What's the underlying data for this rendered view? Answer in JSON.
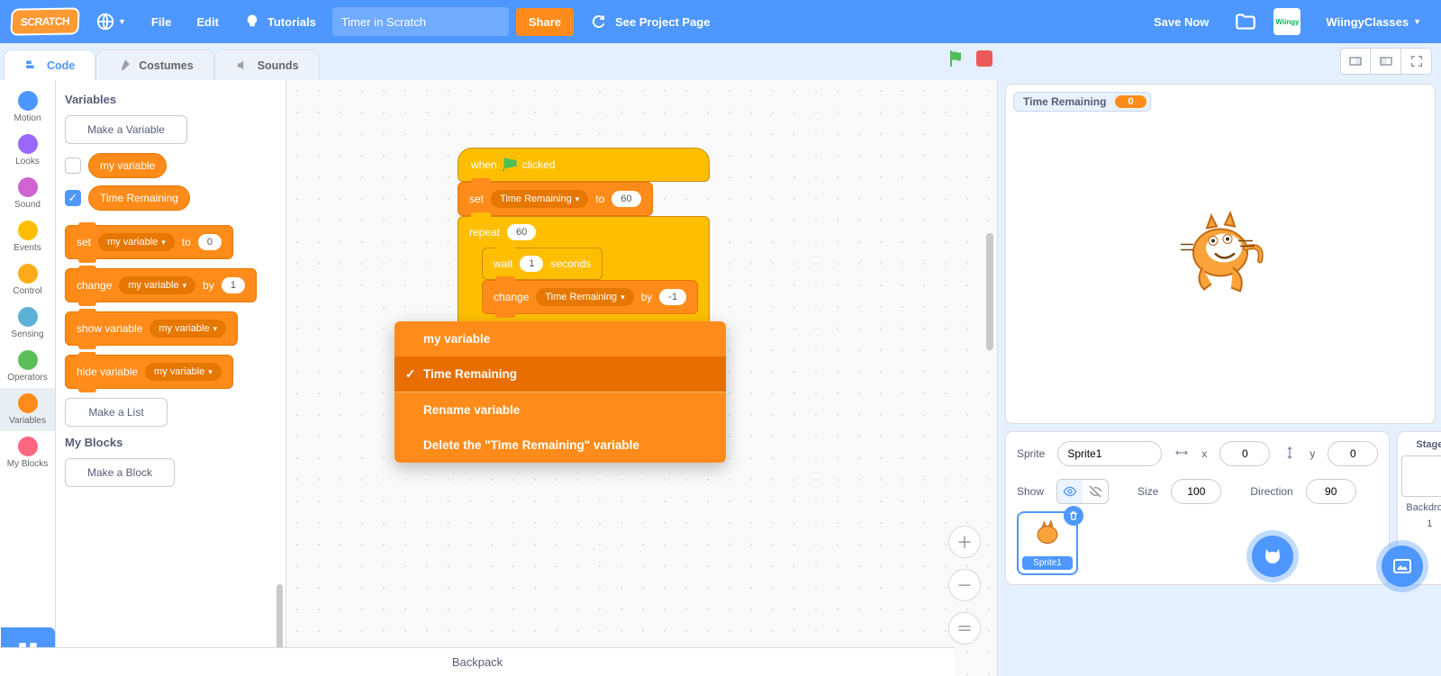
{
  "menubar": {
    "file": "File",
    "edit": "Edit",
    "tutorials": "Tutorials",
    "title": "Timer in Scratch",
    "share": "Share",
    "see_page": "See Project Page",
    "save_now": "Save Now",
    "username": "WiingyClasses",
    "avatar_text": "Wiingy"
  },
  "tabs": {
    "code": "Code",
    "costumes": "Costumes",
    "sounds": "Sounds"
  },
  "categories": [
    {
      "name": "Motion",
      "color": "#4c97ff"
    },
    {
      "name": "Looks",
      "color": "#9966ff"
    },
    {
      "name": "Sound",
      "color": "#cf63cf"
    },
    {
      "name": "Events",
      "color": "#ffbf00"
    },
    {
      "name": "Control",
      "color": "#ffab19"
    },
    {
      "name": "Sensing",
      "color": "#5cb1d6"
    },
    {
      "name": "Operators",
      "color": "#59c059"
    },
    {
      "name": "Variables",
      "color": "#ff8c1a"
    },
    {
      "name": "My Blocks",
      "color": "#ff6680"
    }
  ],
  "palette": {
    "h_variables": "Variables",
    "make_variable": "Make a Variable",
    "var1": "my variable",
    "var2": "Time Remaining",
    "set": "set",
    "to": "to",
    "zero": "0",
    "change": "change",
    "by": "by",
    "one": "1",
    "show": "show variable",
    "hide": "hide variable",
    "make_list": "Make a List",
    "h_myblocks": "My Blocks",
    "make_block": "Make a Block",
    "dd": "my variable"
  },
  "script": {
    "when": "when",
    "clicked": "clicked",
    "set": "set",
    "to": "to",
    "v_time": "Time Remaining",
    "val60": "60",
    "repeat": "repeat",
    "rep_n": "60",
    "wait": "wait",
    "wait_n": "1",
    "seconds": "seconds",
    "change": "change",
    "by": "by",
    "neg1": "-1"
  },
  "ctx": {
    "opt1": "my variable",
    "opt2": "Time Remaining",
    "rename": "Rename variable",
    "delete": "Delete the \"Time Remaining\" variable"
  },
  "stage": {
    "var_label": "Time Remaining",
    "var_val": "0"
  },
  "sprite": {
    "label_sprite": "Sprite",
    "name": "Sprite1",
    "x_label": "x",
    "x": "0",
    "y_label": "y",
    "y": "0",
    "show": "Show",
    "size_label": "Size",
    "size": "100",
    "dir_label": "Direction",
    "dir": "90"
  },
  "stage_panel": {
    "title": "Stage",
    "backdrops_label": "Backdrops",
    "count": "1"
  },
  "sprite_item": {
    "name": "Sprite1"
  },
  "backpack": "Backpack"
}
